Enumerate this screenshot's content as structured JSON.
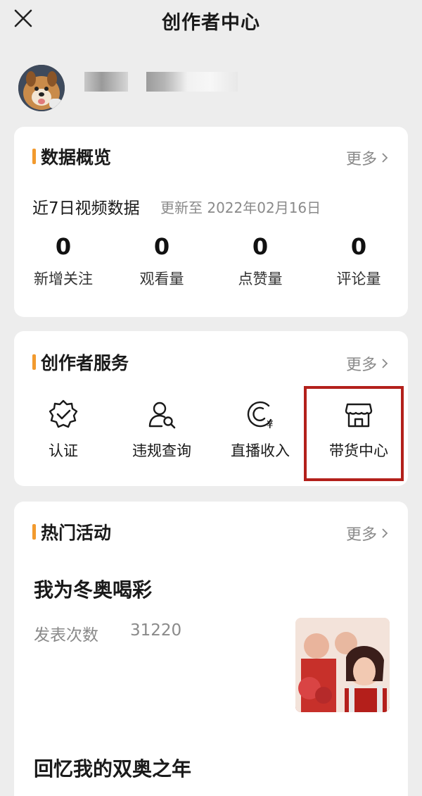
{
  "header": {
    "title": "创作者中心",
    "close_icon": "close-icon"
  },
  "data_overview": {
    "title": "数据概览",
    "more": "更多",
    "subtitle": "近7日视频数据",
    "updated": "更新至 2022年02月16日",
    "stats": [
      {
        "value": "0",
        "label": "新增关注"
      },
      {
        "value": "0",
        "label": "观看量"
      },
      {
        "value": "0",
        "label": "点赞量"
      },
      {
        "value": "0",
        "label": "评论量"
      }
    ]
  },
  "creator_services": {
    "title": "创作者服务",
    "more": "更多",
    "items": [
      {
        "label": "认证",
        "icon": "verified-badge-icon"
      },
      {
        "label": "违规查询",
        "icon": "user-search-icon"
      },
      {
        "label": "直播收入",
        "icon": "live-income-icon"
      },
      {
        "label": "带货中心",
        "icon": "store-icon"
      }
    ]
  },
  "hot_activities": {
    "title": "热门活动",
    "more": "更多",
    "items": [
      {
        "title": "我为冬奥喝彩",
        "meta_label": "发表次数",
        "meta_value": "31220"
      },
      {
        "title": "回忆我的双奥之年"
      }
    ]
  },
  "colors": {
    "accent": "#f29a2e",
    "highlight": "#b3201b",
    "background": "#ededed"
  }
}
